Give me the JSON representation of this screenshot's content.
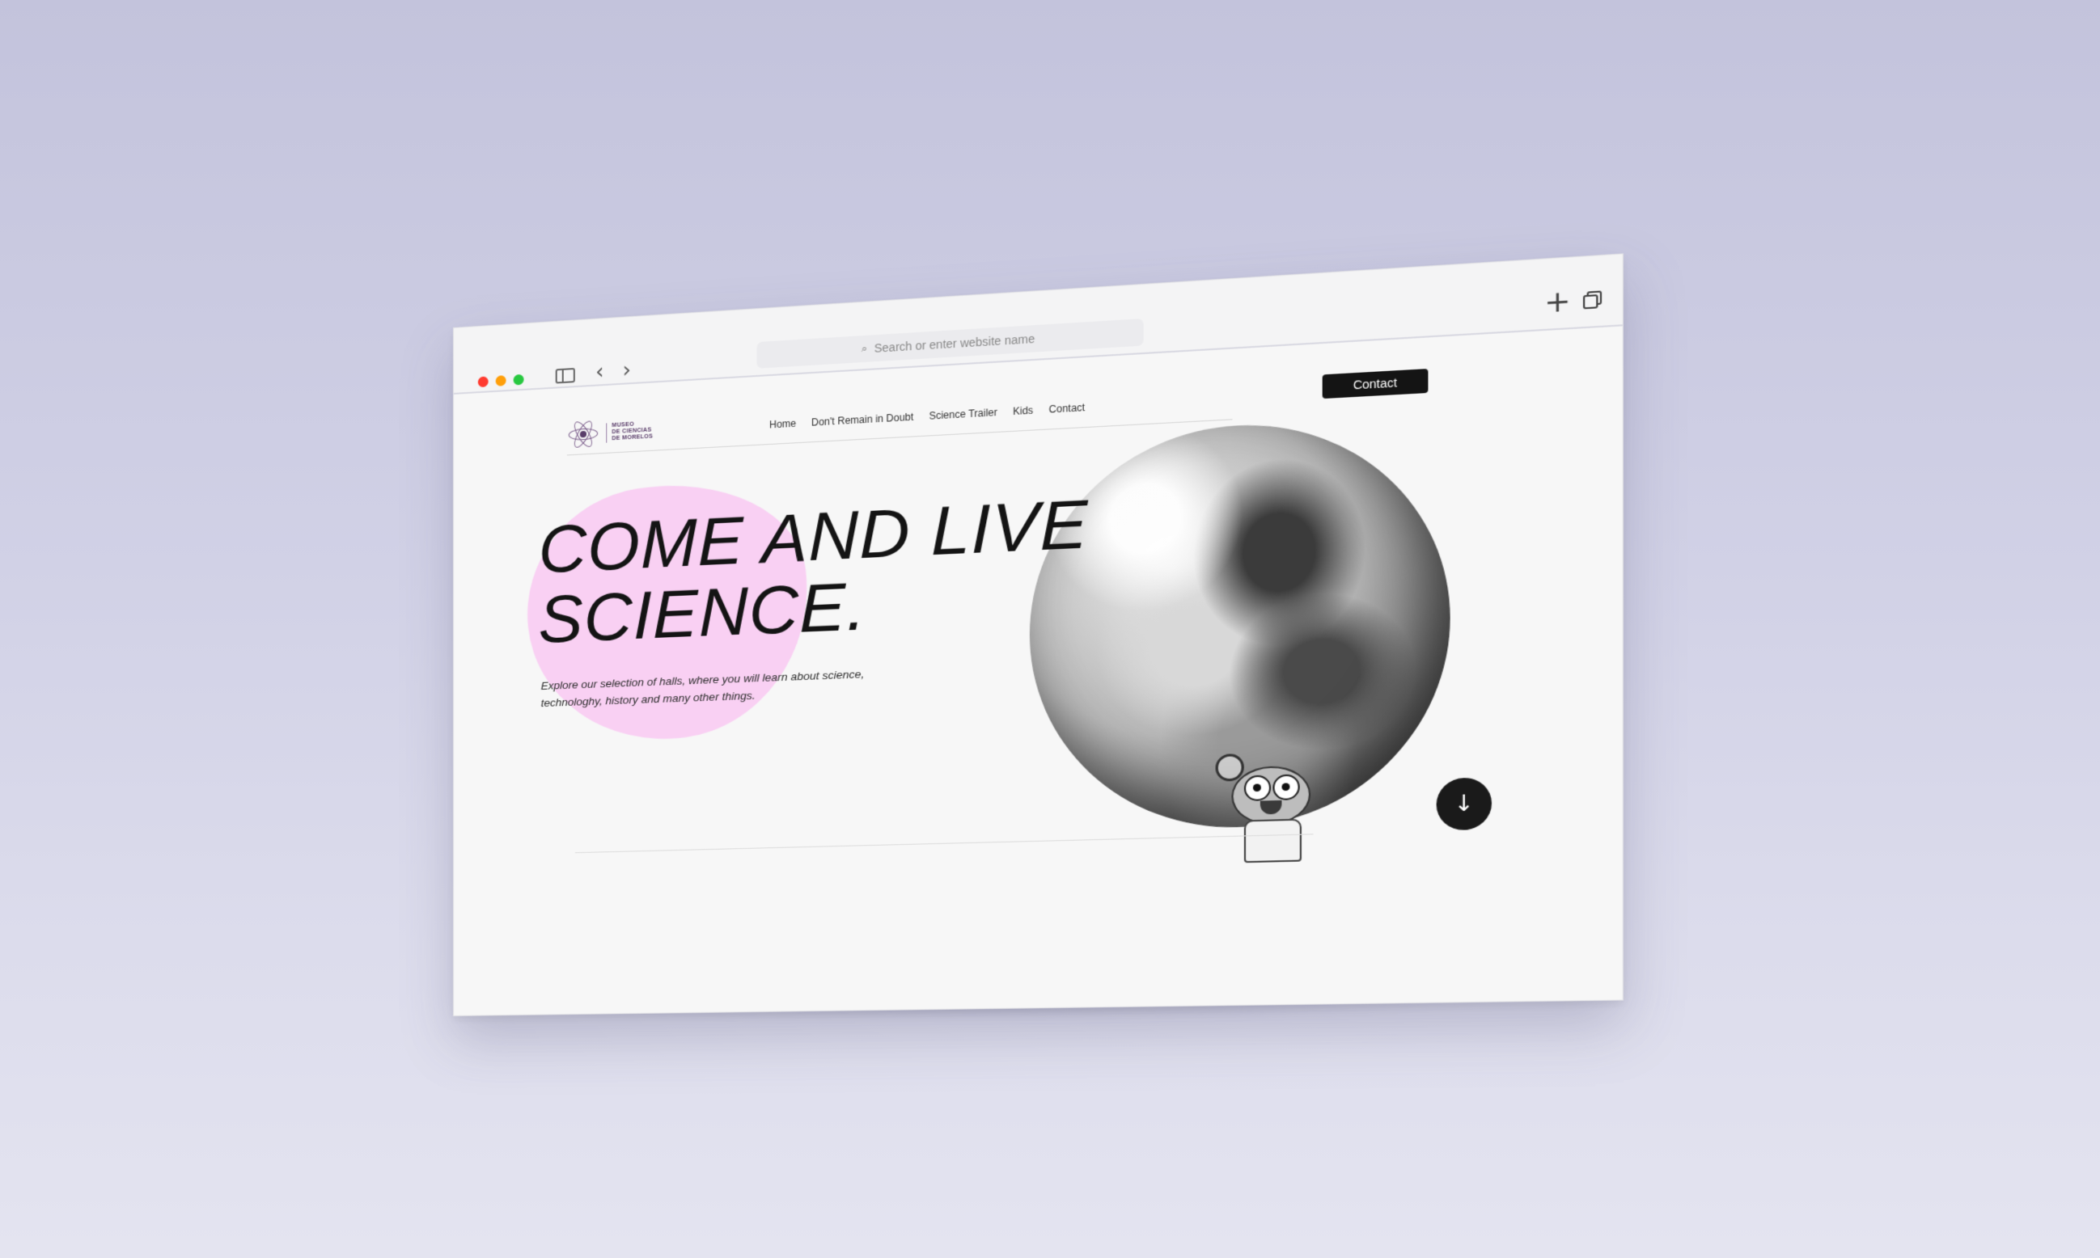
{
  "browser": {
    "url_placeholder": "Search or enter website name",
    "traffic_colors": [
      "#ff3b30",
      "#ff9f0a",
      "#28c840"
    ],
    "icons": [
      "sidebar-icon",
      "back-arrow-icon",
      "forward-arrow-icon",
      "search-icon",
      "new-tab-plus-icon",
      "tabs-overview-icon"
    ]
  },
  "site": {
    "logo_lines": [
      "MUSEO",
      "DE CIENCIAS",
      "DE MORELOS"
    ],
    "nav": [
      "Home",
      "Don't Remain in Doubt",
      "Science Trailer",
      "Kids",
      "Contact"
    ],
    "contact_button": "Contact",
    "hero": {
      "title_line1": "COME AND LIVE",
      "title_line2": "SCIENCE.",
      "subtitle": "Explore our selection of halls, where you will learn about science, technologhy, history and many other things."
    },
    "scroll_icon": "arrow-down-icon",
    "accent_color": "#f9d0f3"
  }
}
